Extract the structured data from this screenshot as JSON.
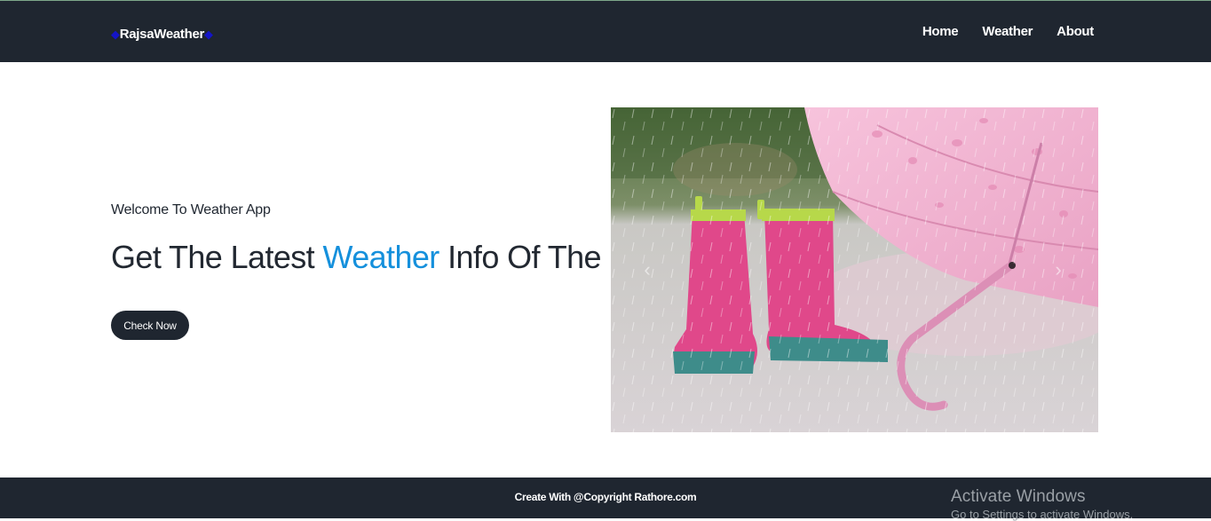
{
  "brand": {
    "name": "RajsaWeather",
    "accent_color": "#1414c8"
  },
  "nav": {
    "items": [
      {
        "label": "Home"
      },
      {
        "label": "Weather"
      },
      {
        "label": "About"
      }
    ]
  },
  "hero": {
    "welcome": "Welcome To Weather App",
    "headline_before": "Get The Latest ",
    "headline_accent": "Weather",
    "headline_after": " Info Of The City",
    "accent_color": "#1590dc",
    "cta_label": "Check Now",
    "image_alt_icon": "rain-boots-umbrella-image"
  },
  "carousel": {
    "prev_icon": "chevron-left-icon",
    "next_icon": "chevron-right-icon"
  },
  "footer": {
    "text": "Create With @Copyright Rathore.com"
  },
  "watermark": {
    "title": "Activate Windows",
    "subtitle": "Go to Settings to activate Windows."
  },
  "colors": {
    "navbar": "#1f2630",
    "footer": "#1f2630",
    "background": "#ffffff"
  }
}
